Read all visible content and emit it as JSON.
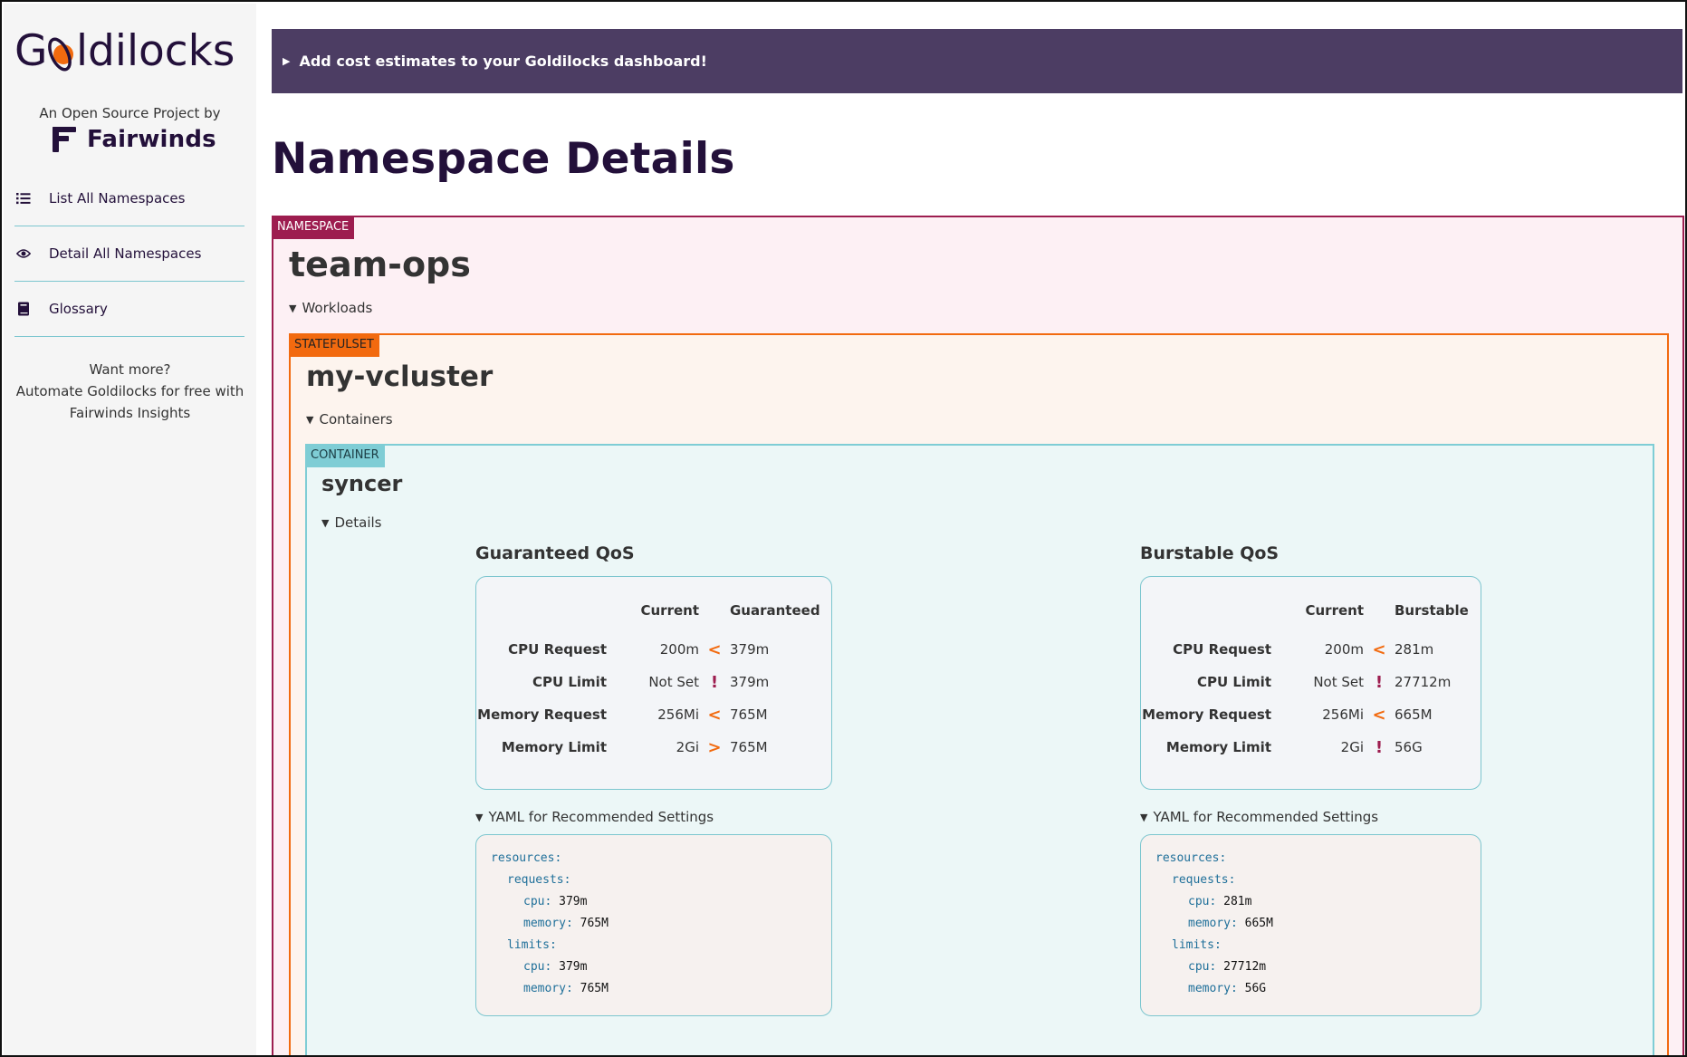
{
  "sidebar": {
    "logo_text": "Goldilocks",
    "byline": "An Open Source Project by",
    "brand": "Fairwinds",
    "nav": [
      {
        "label": "List All Namespaces",
        "icon": "list-icon"
      },
      {
        "label": "Detail All Namespaces",
        "icon": "eye-icon"
      },
      {
        "label": "Glossary",
        "icon": "book-icon"
      }
    ],
    "promo_line1": "Want more?",
    "promo_line2": "Automate Goldilocks for free with",
    "promo_line3": "Fairwinds Insights"
  },
  "banner": {
    "text": "Add cost estimates to your Goldilocks dashboard!"
  },
  "page_title": "Namespace Details",
  "namespace": {
    "tag": "NAMESPACE",
    "name": "team-ops",
    "workloads_toggle": "Workloads",
    "statefulset": {
      "tag": "STATEFULSET",
      "name": "my-vcluster",
      "containers_toggle": "Containers",
      "container": {
        "tag": "CONTAINER",
        "name": "syncer",
        "details_toggle": "Details",
        "guaranteed": {
          "title": "Guaranteed QoS",
          "col_current": "Current",
          "col_rec": "Guaranteed",
          "rows": [
            {
              "label": "CPU Request",
              "current": "200m",
              "symbol": "<",
              "rec": "379m"
            },
            {
              "label": "CPU Limit",
              "current": "Not Set",
              "symbol": "!",
              "rec": "379m"
            },
            {
              "label": "Memory Request",
              "current": "256Mi",
              "symbol": "<",
              "rec": "765M"
            },
            {
              "label": "Memory Limit",
              "current": "2Gi",
              "symbol": ">",
              "rec": "765M"
            }
          ],
          "yaml_toggle": "YAML for Recommended Settings",
          "yaml": {
            "resources": "resources",
            "requests": "requests",
            "limits": "limits",
            "cpu_key": "cpu",
            "memory_key": "memory",
            "req_cpu": "379m",
            "req_mem": "765M",
            "lim_cpu": "379m",
            "lim_mem": "765M"
          }
        },
        "burstable": {
          "title": "Burstable QoS",
          "col_current": "Current",
          "col_rec": "Burstable",
          "rows": [
            {
              "label": "CPU Request",
              "current": "200m",
              "symbol": "<",
              "rec": "281m"
            },
            {
              "label": "CPU Limit",
              "current": "Not Set",
              "symbol": "!",
              "rec": "27712m"
            },
            {
              "label": "Memory Request",
              "current": "256Mi",
              "symbol": "<",
              "rec": "665M"
            },
            {
              "label": "Memory Limit",
              "current": "2Gi",
              "symbol": "!",
              "rec": "56G"
            }
          ],
          "yaml_toggle": "YAML for Recommended Settings",
          "yaml": {
            "resources": "resources",
            "requests": "requests",
            "limits": "limits",
            "cpu_key": "cpu",
            "memory_key": "memory",
            "req_cpu": "281m",
            "req_mem": "665M",
            "lim_cpu": "27712m",
            "lim_mem": "56G"
          }
        }
      }
    }
  },
  "colors": {
    "brand_dark": "#23103a",
    "banner": "#4c3d63",
    "namespace": "#9d1d4f",
    "statefulset": "#f26a0f",
    "container": "#7fcdd5",
    "divider": "#7cc6cf"
  }
}
